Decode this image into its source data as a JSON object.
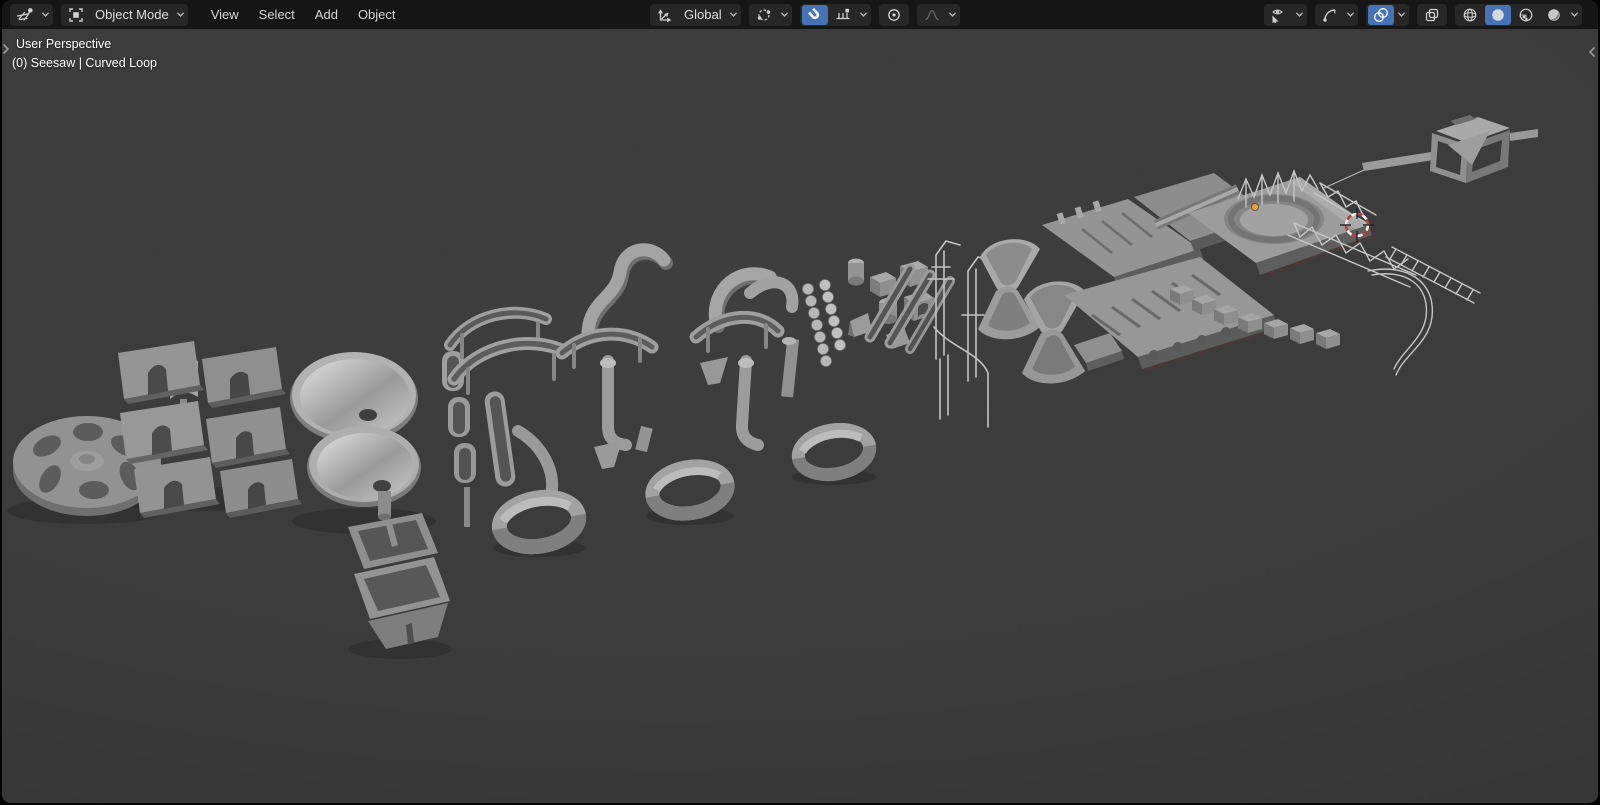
{
  "colors": {
    "header_bg": "#161616",
    "button_bg": "#272727",
    "accent_blue": "#4772b3",
    "header_text": "#d6d6d6",
    "viewport_bg": "#3b3b3b",
    "object_gray": "#9a9a9a",
    "origin_orange": "#e8a33d",
    "cursor_red": "#b6423c"
  },
  "header": {
    "editor_type": {
      "icon": "editor-3d-viewport-icon",
      "chevron": "chevron-down-icon"
    },
    "mode": {
      "label": "Object Mode",
      "icon": "object-mode-icon",
      "chevron": "chevron-down-icon"
    },
    "menus": [
      {
        "label": "View"
      },
      {
        "label": "Select"
      },
      {
        "label": "Add"
      },
      {
        "label": "Object"
      }
    ],
    "transform_orientation": {
      "label": "Global",
      "icon": "orientation-axes-icon",
      "chevron": "chevron-down-icon"
    },
    "pivot_point": {
      "icon": "pivot-point-icon",
      "chevron": "chevron-down-icon"
    },
    "snapping": {
      "enabled": true,
      "magnet_icon": "magnet-icon",
      "target_icon": "snap-increment-icon",
      "chevron": "chevron-down-icon"
    },
    "proportional_editing": {
      "enabled": false,
      "icon": "proportional-editing-icon",
      "falloff_icon": "falloff-curve-icon"
    },
    "visibility": {
      "icon": "visibility-cursor-eye-icon",
      "chevron": "chevron-down-icon"
    },
    "gizmos": {
      "enabled": false,
      "icon": "gizmo-arc-icon",
      "chevron": "chevron-down-icon"
    },
    "overlays": {
      "enabled": true,
      "icon": "overlays-circles-icon",
      "chevron": "chevron-down-icon"
    },
    "xray": {
      "enabled": false,
      "icon": "xray-squares-icon"
    },
    "shading": {
      "modes": [
        {
          "name": "wireframe",
          "icon": "shading-wireframe-icon",
          "active": false
        },
        {
          "name": "solid",
          "icon": "shading-solid-icon",
          "active": true
        },
        {
          "name": "material-preview",
          "icon": "shading-material-icon",
          "active": false
        },
        {
          "name": "rendered",
          "icon": "shading-rendered-icon",
          "active": false
        }
      ],
      "chevron": "chevron-down-icon"
    }
  },
  "viewport": {
    "view_label": "User Perspective",
    "active_object": "(0) Seesaw | Curved Loop",
    "has_3d_cursor": true,
    "origin_dot_color": "#e8a33d",
    "scene_objects": [
      "paddle-wheel",
      "arch-gates",
      "funnels",
      "collector-trays",
      "halfpipe-column",
      "pipe-arcs",
      "s-pipes",
      "loop-rings",
      "marble-rows",
      "block-kit",
      "channel-rails",
      "wire-guides",
      "vortex-funnels",
      "ramp-platforms",
      "bowl-platform",
      "truss-bridges",
      "cube-chain",
      "beam-and-cage"
    ]
  }
}
